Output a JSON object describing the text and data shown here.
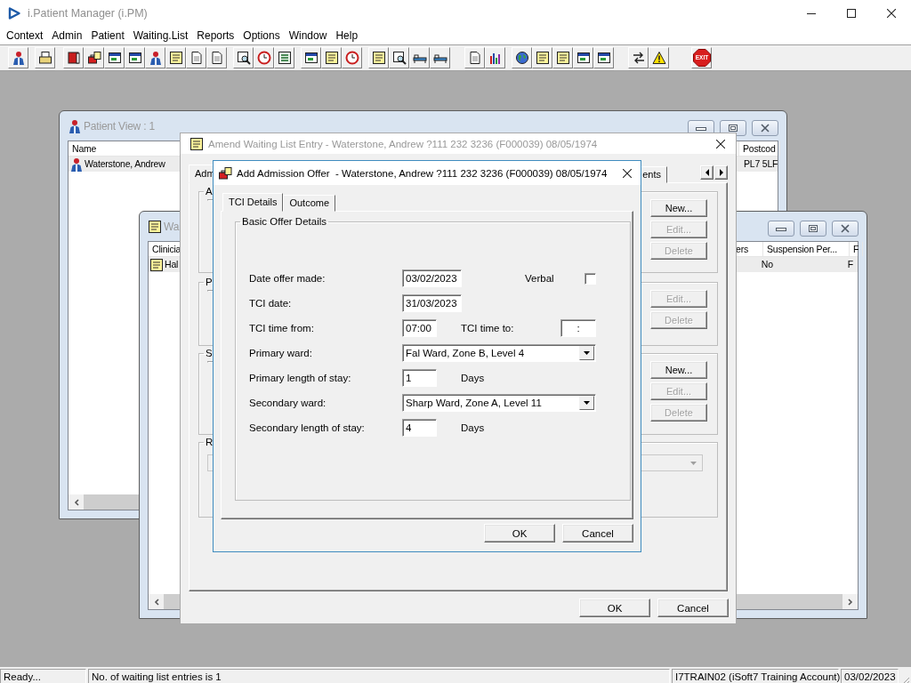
{
  "app": {
    "title": "i.Patient Manager (i.PM)"
  },
  "menu": [
    "Context",
    "Admin",
    "Patient",
    "Waiting.List",
    "Reports",
    "Options",
    "Window",
    "Help"
  ],
  "toolbar": {
    "exit_label": "EXIT"
  },
  "windows": [
    {
      "kind": "patient_list",
      "title": "Patient View : 1",
      "active": false,
      "row_selected": true,
      "columns": [
        {
          "header": "Name",
          "cell": "Waterstone, Andrew"
        },
        {
          "header": "Postcod",
          "cell": "PL7 5LF"
        }
      ]
    },
    {
      "kind": "waiting_list",
      "title": "Wa",
      "active": false,
      "row_selected": true,
      "columns": [
        {
          "header": "Clinicia",
          "cell": "Hal"
        },
        {
          "header": "ers"
        },
        {
          "header": "Suspension Per...",
          "cell": "No"
        },
        {
          "header": "F",
          "cell": "F"
        }
      ]
    },
    {
      "kind": "entry",
      "title": "Amend Waiting List Entry - Waterstone, Andrew ?111 232 3236 (F000039) 08/05/1974",
      "active": false,
      "tabs": [
        {
          "label": "Adm",
          "selected": true
        },
        {
          "label": "ents",
          "selected": false
        }
      ],
      "groups": [
        {
          "kind": "buttons",
          "label": "A",
          "buttons": [
            {
              "label": "New...",
              "disabled": false
            },
            {
              "label": "Edit...",
              "disabled": true
            },
            {
              "label": "Delete",
              "disabled": true
            }
          ]
        },
        {
          "kind": "buttons",
          "label": "P",
          "buttons": [
            {
              "label": "Edit...",
              "disabled": true
            },
            {
              "label": "Delete",
              "disabled": true
            }
          ]
        },
        {
          "kind": "buttons",
          "label": "S",
          "buttons": [
            {
              "label": "New...",
              "disabled": false
            },
            {
              "label": "Edit...",
              "disabled": true
            },
            {
              "label": "Delete",
              "disabled": true
            }
          ]
        },
        {
          "kind": "dropdown",
          "label": "R",
          "disabled": true
        }
      ],
      "buttons": [
        "OK",
        "Cancel"
      ]
    },
    {
      "kind": "dialog",
      "title": "Add Admission Offer  - Waterstone, Andrew ?111 232 3236 (F000039) 08/05/1974",
      "active": true,
      "tabs": [
        {
          "label": "TCI Details",
          "selected": true
        },
        {
          "label": "Outcome",
          "selected": false
        }
      ],
      "group": "Basic Offer Details",
      "rows": [
        {
          "kind": "date",
          "label": "Date offer made:",
          "value": "03/02/2023",
          "check": {
            "label": "Verbal",
            "checked": false
          }
        },
        {
          "kind": "date",
          "label": "TCI date:",
          "value": "31/03/2023"
        },
        {
          "kind": "time",
          "label": "TCI time from:",
          "value": "07:00",
          "to": {
            "label": "TCI time to:",
            "value": ":"
          }
        },
        {
          "kind": "select",
          "label": "Primary ward:",
          "value": "Fal Ward, Zone B, Level 4"
        },
        {
          "kind": "number",
          "label": "Primary length of stay:",
          "value": "1",
          "unit": "Days"
        },
        {
          "kind": "select",
          "label": "Secondary ward:",
          "value": "Sharp Ward, Zone A, Level 11"
        },
        {
          "kind": "number",
          "label": "Secondary length of stay:",
          "value": "4",
          "unit": "Days"
        }
      ],
      "buttons": [
        "OK",
        "Cancel"
      ]
    }
  ],
  "status_bar": [
    "Ready...",
    "No. of waiting list entries is 1",
    "I7TRAIN02 (iSoft7 Training Account)",
    "03/02/2023"
  ]
}
